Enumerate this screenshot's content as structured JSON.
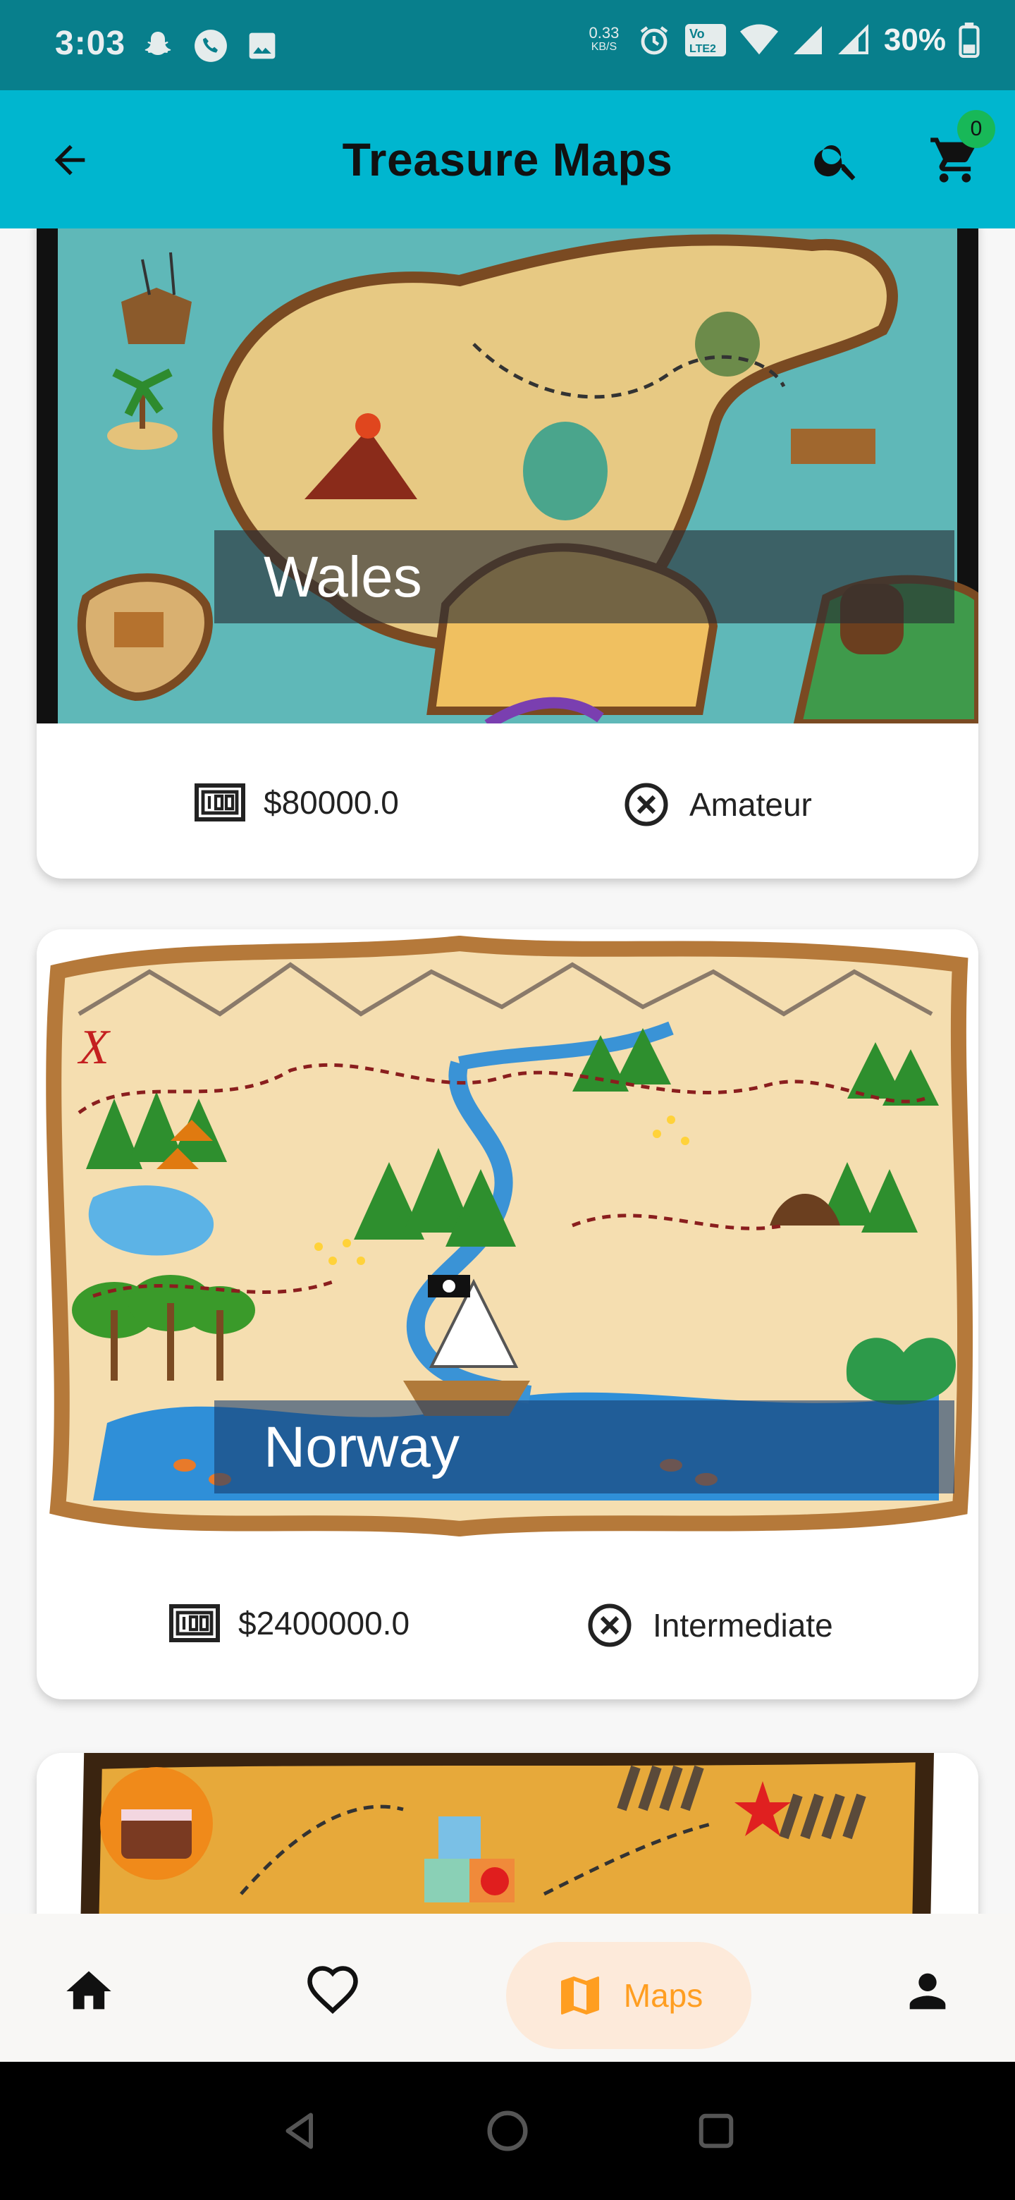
{
  "status_bar": {
    "time": "3:03",
    "speed_value": "0.33",
    "speed_unit": "KB/S",
    "battery": "30%",
    "lte_label": "Vo LTE2"
  },
  "app_bar": {
    "title": "Treasure Maps",
    "cart_count": "0",
    "icons": [
      "arrow-back-icon",
      "search-icon",
      "cart-icon"
    ]
  },
  "maps": [
    {
      "name": "Wales",
      "price": "$80000.0",
      "level": "Amateur",
      "price_icon": "money-icon",
      "level_icon": "cancel-circle-icon"
    },
    {
      "name": "Norway",
      "price": "$2400000.0",
      "level": "Intermediate",
      "price_icon": "money-icon",
      "level_icon": "cancel-circle-icon"
    }
  ],
  "bottom_nav": {
    "items": [
      {
        "icon": "home-icon",
        "label": ""
      },
      {
        "icon": "heart-icon",
        "label": ""
      },
      {
        "icon": "map-icon",
        "label": "Maps",
        "active": true
      },
      {
        "icon": "person-icon",
        "label": ""
      }
    ],
    "active_color": "#ff9e21",
    "active_bg": "#fdeada"
  },
  "colors": {
    "status_bar": "#087f8c",
    "app_bar": "#00b6cf",
    "badge": "#18b858"
  }
}
